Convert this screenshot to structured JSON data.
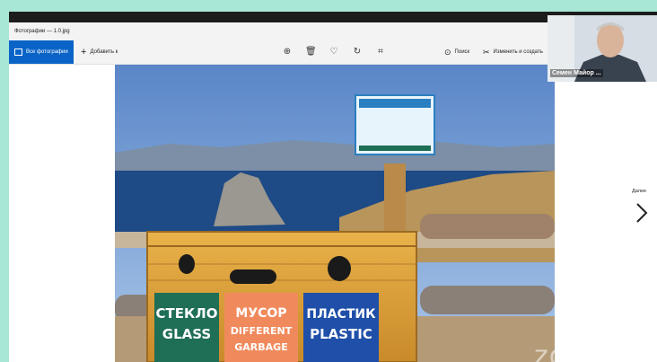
{
  "window": {
    "title": "Фотографии — 1.0.jpg"
  },
  "toolbar": {
    "all_photos": "Все фотографии",
    "add_to": "Добавить к",
    "search": "Поиск",
    "edit_create": "Изменить и создать"
  },
  "photo": {
    "bins": [
      {
        "ru": "СТЕКЛО",
        "en": "GLASS",
        "color": "#1f6e56"
      },
      {
        "ru": "МУСОР",
        "en": "DIFFERENT GARBAGE",
        "en_line1": "DIFFERENT",
        "en_line2": "GARBAGE",
        "color": "#f08a5d"
      },
      {
        "ru": "ПЛАСТИК",
        "en": "PLASTIC",
        "color": "#1f4fa8"
      }
    ]
  },
  "nav": {
    "next_label": "Далее"
  },
  "webcam": {
    "participant_name": "Семен Майор ..."
  },
  "watermark": "zoom",
  "colors": {
    "accent": "#0a64c8",
    "background": "#a8e6d6"
  }
}
